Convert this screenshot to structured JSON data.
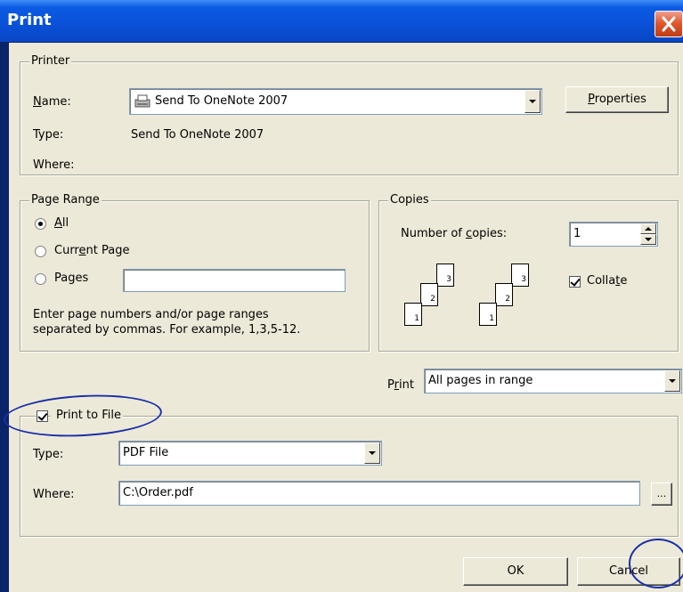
{
  "window": {
    "title": "Print"
  },
  "printer": {
    "legend": "Printer",
    "name_label": "Name:",
    "name_value": "Send To OneNote 2007",
    "properties_label": "Properties",
    "type_label": "Type:",
    "type_value": "Send To OneNote 2007",
    "where_label": "Where:"
  },
  "page_range": {
    "legend": "Page Range",
    "all_label": "All",
    "current_label": "Current Page",
    "pages_label": "Pages",
    "pages_value": "",
    "help_line1": "Enter page numbers and/or page ranges",
    "help_line2": "separated by commas.  For example, 1,3,5-12.",
    "selected": "All"
  },
  "copies": {
    "legend": "Copies",
    "number_label": "Number of copies:",
    "number_value": "1",
    "collate_label": "Collate",
    "collate_checked": true,
    "pages_a": [
      "1",
      "2",
      "3"
    ],
    "pages_b": [
      "1",
      "2",
      "3"
    ]
  },
  "print_what": {
    "label": "Print",
    "value": "All pages in range"
  },
  "print_to_file": {
    "legend": "Print to File",
    "checked": true,
    "type_label": "Type:",
    "type_value": "PDF File",
    "where_label": "Where:",
    "where_value": "C:\\Order.pdf",
    "browse_label": "..."
  },
  "buttons": {
    "ok": "OK",
    "cancel": "Cancel"
  },
  "colors": {
    "title_bar": "#0A52D9",
    "dialog_bg": "#ECE9D8",
    "annotation": "#1A2FA8"
  }
}
